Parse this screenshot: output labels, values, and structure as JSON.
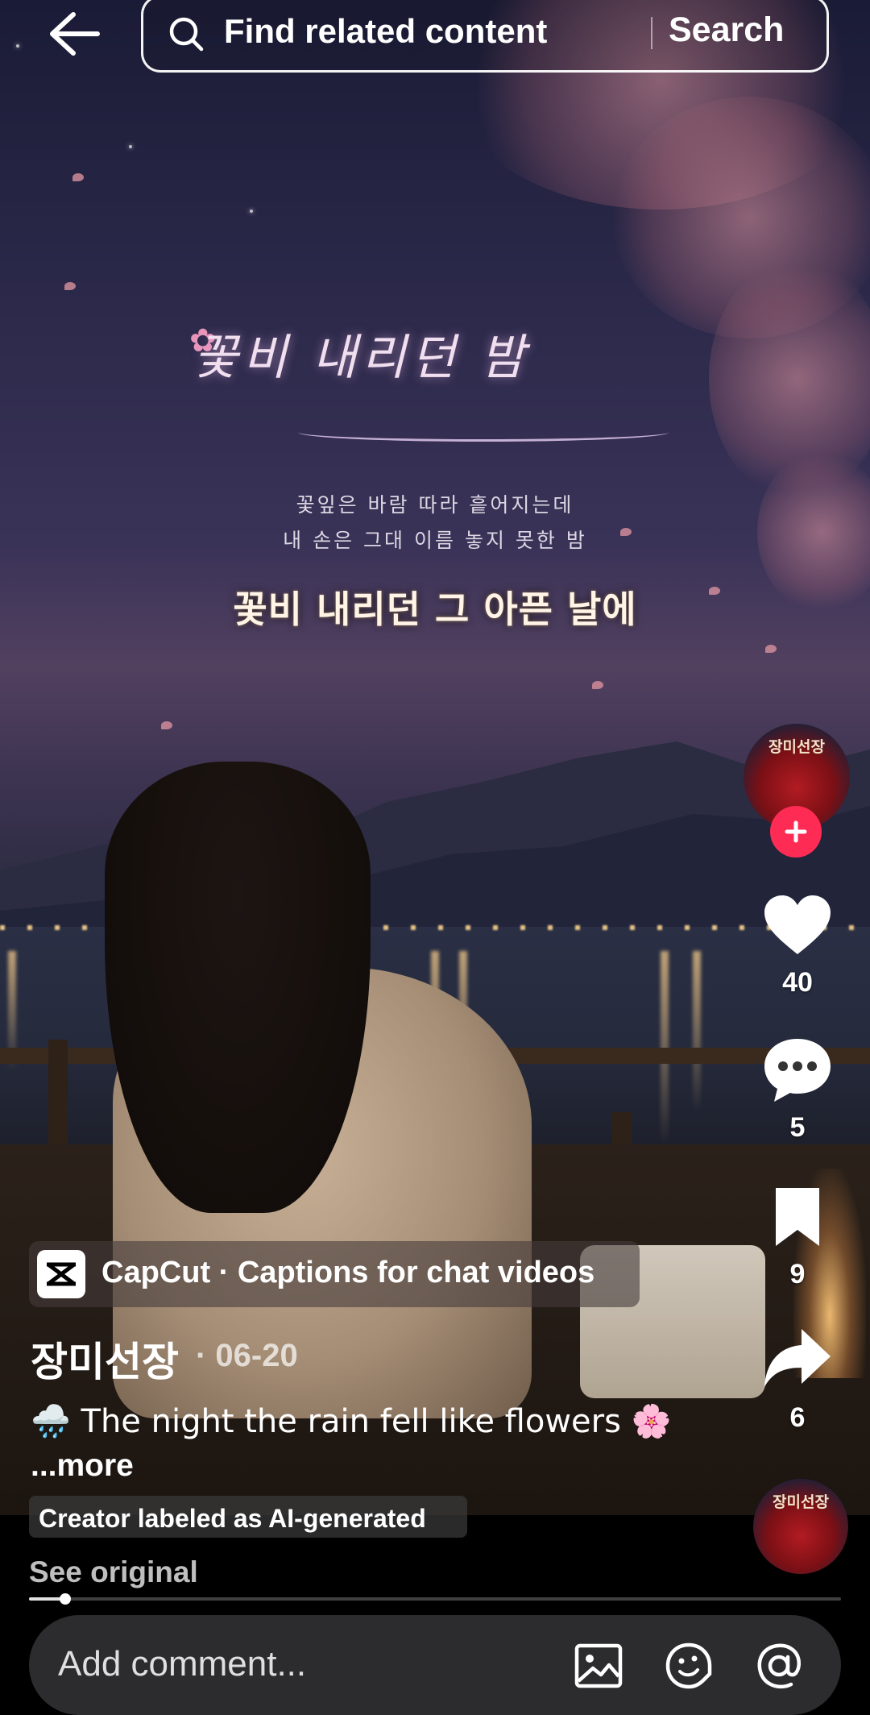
{
  "search": {
    "placeholder": "Find related content",
    "button_label": "Search"
  },
  "video": {
    "poem_title": "꽃비 내리던 밤",
    "poem_line_1": "꽃잎은 바람 따라 흩어지는데",
    "poem_line_2": "내 손은 그대 이름 놓지 못한 밤",
    "caption": "꽃비 내리던 그 아픈 날에"
  },
  "rail": {
    "avatar_label": "장미선장",
    "likes": "40",
    "comments": "5",
    "saves": "9",
    "shares": "6"
  },
  "info": {
    "capcut_label": "CapCut · Captions for chat videos",
    "author": "장미선장",
    "date": "· 06-20",
    "description": "🌧️ The night the rain fell like flowers 🌸",
    "more": "...more",
    "ai_label": "Creator labeled as AI-generated",
    "see_original": "See original"
  },
  "playback": {
    "progress_fraction": 0.045
  },
  "comment": {
    "placeholder": "Add comment..."
  },
  "colors": {
    "follow": "#fe2c55",
    "comment_bar": "#2c2c2e"
  },
  "icons": [
    "back-arrow-icon",
    "search-icon",
    "plus-icon",
    "heart-icon",
    "comment-bubble-icon",
    "bookmark-icon",
    "share-arrow-icon",
    "image-icon",
    "emoji-icon",
    "mention-icon"
  ]
}
